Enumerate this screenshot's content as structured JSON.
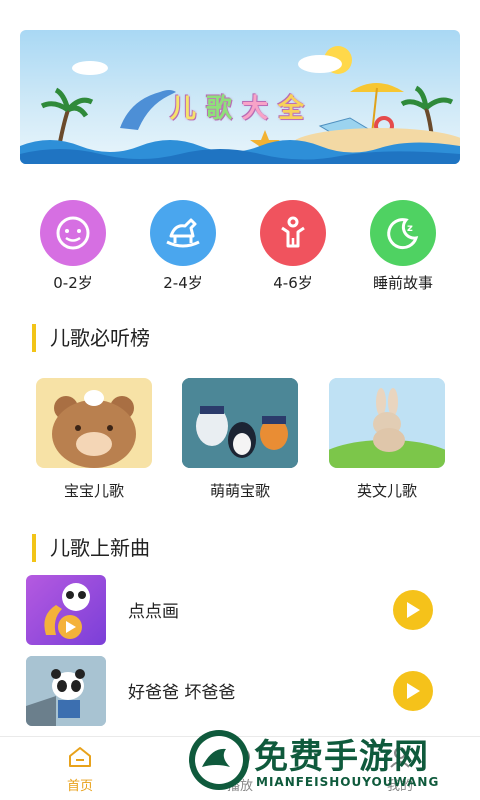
{
  "banner": {
    "title_chars": [
      "儿",
      "歌",
      "大",
      "全"
    ]
  },
  "categories": [
    {
      "label": "0-2岁",
      "color": "#d66fe2",
      "icon": "baby-face-icon"
    },
    {
      "label": "2-4岁",
      "color": "#4aa6ee",
      "icon": "rocking-horse-icon"
    },
    {
      "label": "4-6岁",
      "color": "#f0535e",
      "icon": "child-figure-icon"
    },
    {
      "label": "睡前故事",
      "color": "#4fd262",
      "icon": "moon-sleep-icon"
    }
  ],
  "sections": {
    "recommended": "儿歌必听榜",
    "new_songs": "儿歌上新曲"
  },
  "recommended": [
    {
      "label": "宝宝儿歌"
    },
    {
      "label": "萌萌宝歌"
    },
    {
      "label": "英文儿歌"
    }
  ],
  "songs": [
    {
      "name": "点点画"
    },
    {
      "name": "好爸爸 坏爸爸"
    }
  ],
  "tabs": [
    {
      "label": "首页",
      "active": true,
      "active_color": "#e8a21b"
    },
    {
      "label": "播放"
    },
    {
      "label": "我的"
    }
  ],
  "watermark": {
    "title": "免费手游网",
    "subtitle": "MIANFEISHOUYOUWANG"
  }
}
